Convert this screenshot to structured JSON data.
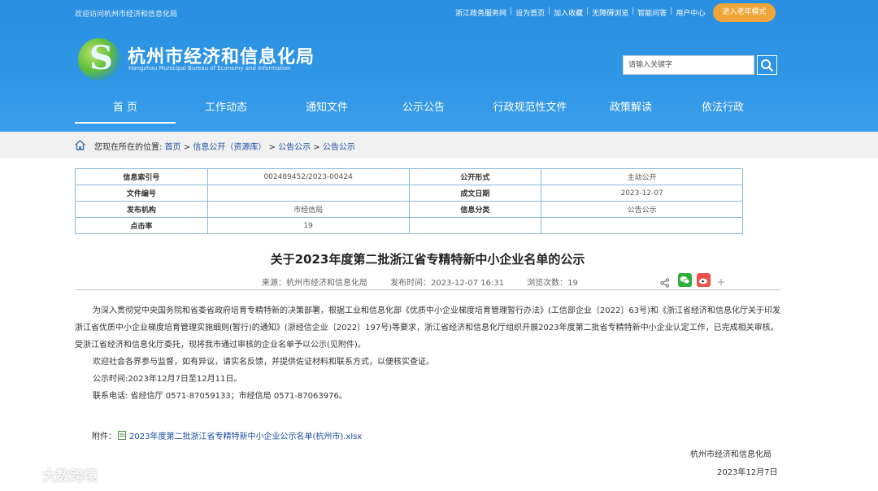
{
  "header": {
    "welcome": "欢迎访问杭州市经济和信息化局",
    "top_links": [
      "浙江政务服务网",
      "设为首页",
      "加入收藏",
      "无障碍浏览",
      "智能问答",
      "用户中心"
    ],
    "elder_mode": "进入老年模式",
    "title": "杭州市经济和信息化局",
    "subtitle": "Hangzhou Municipal Bureau of Economy and Information",
    "search_placeholder": "请输入关键字"
  },
  "nav": [
    "首 页",
    "工作动态",
    "通知文件",
    "公示公告",
    "行政规范性文件",
    "政策解读",
    "依法行政"
  ],
  "breadcrumb": {
    "prefix": "您现在所在的位置:",
    "items": [
      "首页",
      "信息公开（资源库）",
      "公告公示",
      "公告公示"
    ],
    "sep": ">"
  },
  "info": [
    [
      "信息索引号",
      "002489452/2023-00424",
      "公开形式",
      "主动公开"
    ],
    [
      "文件编号",
      "",
      "成文日期",
      "2023-12-07"
    ],
    [
      "发布机构",
      "市经信局",
      "信息分类",
      "公告公示"
    ],
    [
      "点击率",
      "19",
      "",
      ""
    ]
  ],
  "article": {
    "title": "关于2023年度第二批浙江省专精特新中小企业名单的公示",
    "source": "来源：杭州市经济和信息化局",
    "published": "发布时间：2023-12-07 16:31",
    "views": "浏览次数：19",
    "para1": "为深入贯彻党中央国务院和省委省政府培育专精特新的决策部署，根据工业和信息化部《优质中小企业梯度培育管理暂行办法》(工信部企业〔2022〕63号)和《浙江省经济和信息化厅关于印发浙江省优质中小企业梯度培育管理实施细则(暂行)的通知》(浙经信企业〔2022〕197号)等要求，浙江省经济和信息化厅组织开展2023年度第二批省专精特新中小企业认定工作，已完成相关审核。受浙江省经济和信息化厅委托，现将我市通过审核的企业名单予以公示(见附件)。",
    "para2": "欢迎社会各界参与监督，如有异议，请实名反馈，并提供佐证材料和联系方式，以便核实查证。",
    "para3": "公示时间:2023年12月7日至12月11日。",
    "para4": "联系电话: 省经信厅 0571-87059133；市经信局 0571-87063976。",
    "attach_label": "附件：",
    "attach_file": "2023年度第二批浙江省专精特新中小企业公示名单(杭州市).xlsx",
    "sign_org": "杭州市经济和信息化局",
    "sign_date": "2023年12月7日"
  },
  "watermark": "大数跨境",
  "colors": {
    "header_blue": "#2f96e6",
    "link_blue": "#1a4fa0",
    "elder_orange": "#f0a53a"
  }
}
